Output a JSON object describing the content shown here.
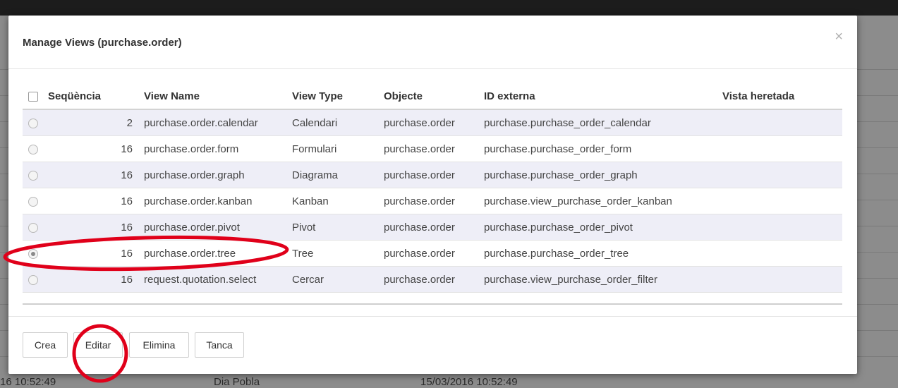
{
  "background": {
    "bottom_texts": [
      "16 10:52:49",
      "Dia Pobla",
      "15/03/2016 10:52:49"
    ]
  },
  "modal": {
    "title": "Manage Views (purchase.order)",
    "close_label": "×"
  },
  "table": {
    "headers": [
      "Seqüència",
      "View Name",
      "View Type",
      "Objecte",
      "ID externa",
      "Vista heretada"
    ],
    "rows": [
      {
        "sequence": "2",
        "view_name": "purchase.order.calendar",
        "view_type": "Calendari",
        "object": "purchase.order",
        "external_id": "purchase.purchase_order_calendar",
        "inherited": ""
      },
      {
        "sequence": "16",
        "view_name": "purchase.order.form",
        "view_type": "Formulari",
        "object": "purchase.order",
        "external_id": "purchase.purchase_order_form",
        "inherited": ""
      },
      {
        "sequence": "16",
        "view_name": "purchase.order.graph",
        "view_type": "Diagrama",
        "object": "purchase.order",
        "external_id": "purchase.purchase_order_graph",
        "inherited": ""
      },
      {
        "sequence": "16",
        "view_name": "purchase.order.kanban",
        "view_type": "Kanban",
        "object": "purchase.order",
        "external_id": "purchase.view_purchase_order_kanban",
        "inherited": ""
      },
      {
        "sequence": "16",
        "view_name": "purchase.order.pivot",
        "view_type": "Pivot",
        "object": "purchase.order",
        "external_id": "purchase.purchase_order_pivot",
        "inherited": ""
      },
      {
        "sequence": "16",
        "view_name": "purchase.order.tree",
        "view_type": "Tree",
        "object": "purchase.order",
        "external_id": "purchase.purchase_order_tree",
        "inherited": "",
        "selected": true
      },
      {
        "sequence": "16",
        "view_name": "request.quotation.select",
        "view_type": "Cercar",
        "object": "purchase.order",
        "external_id": "purchase.view_purchase_order_filter",
        "inherited": ""
      }
    ]
  },
  "buttons": {
    "create": "Crea",
    "edit": "Editar",
    "delete": "Elimina",
    "close": "Tanca"
  },
  "colors": {
    "annotation": "#e0001a",
    "row_stripe": "#eeeef7"
  }
}
